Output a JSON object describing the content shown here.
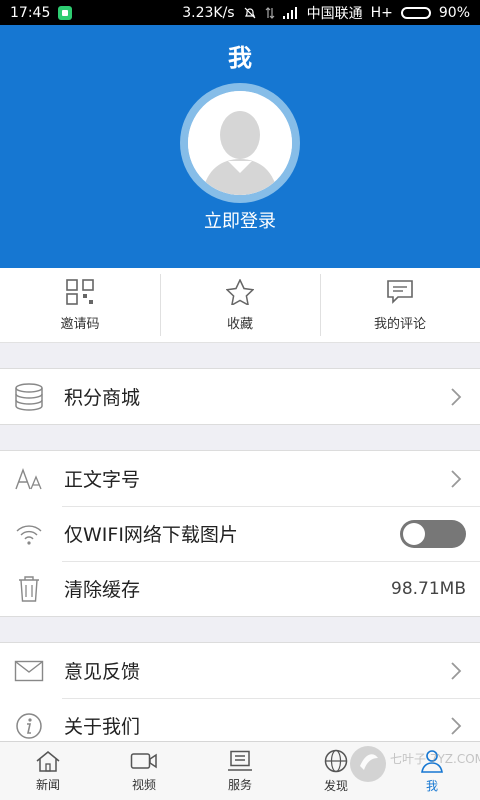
{
  "statusbar": {
    "time": "17:45",
    "speed": "3.23K/s",
    "carrier": "中国联通",
    "network": "H+",
    "battery": "90%"
  },
  "header": {
    "title": "我",
    "login": "立即登录",
    "bg_color": "#1677d2"
  },
  "quick": [
    {
      "label": "邀请码",
      "icon": "qr-code-icon"
    },
    {
      "label": "收藏",
      "icon": "star-icon"
    },
    {
      "label": "我的评论",
      "icon": "comment-icon"
    }
  ],
  "groups": {
    "mall": {
      "label": "积分商城",
      "icon": "database-icon"
    },
    "font": {
      "label": "正文字号",
      "icon": "font-size-icon"
    },
    "wifi": {
      "label": "仅WIFI网络下载图片",
      "icon": "wifi-icon",
      "toggle": "off"
    },
    "cache": {
      "label": "清除缓存",
      "value": "98.71MB",
      "icon": "trash-icon"
    },
    "feedback": {
      "label": "意见反馈",
      "icon": "mail-icon"
    },
    "about": {
      "label": "关于我们",
      "icon": "info-icon"
    }
  },
  "tabs": [
    {
      "label": "新闻",
      "icon": "home-icon"
    },
    {
      "label": "视频",
      "icon": "video-icon"
    },
    {
      "label": "服务",
      "icon": "service-icon"
    },
    {
      "label": "发现",
      "icon": "globe-icon"
    },
    {
      "label": "我",
      "icon": "user-icon",
      "active": true
    }
  ],
  "watermark": "七叶子 7YZ.COM"
}
